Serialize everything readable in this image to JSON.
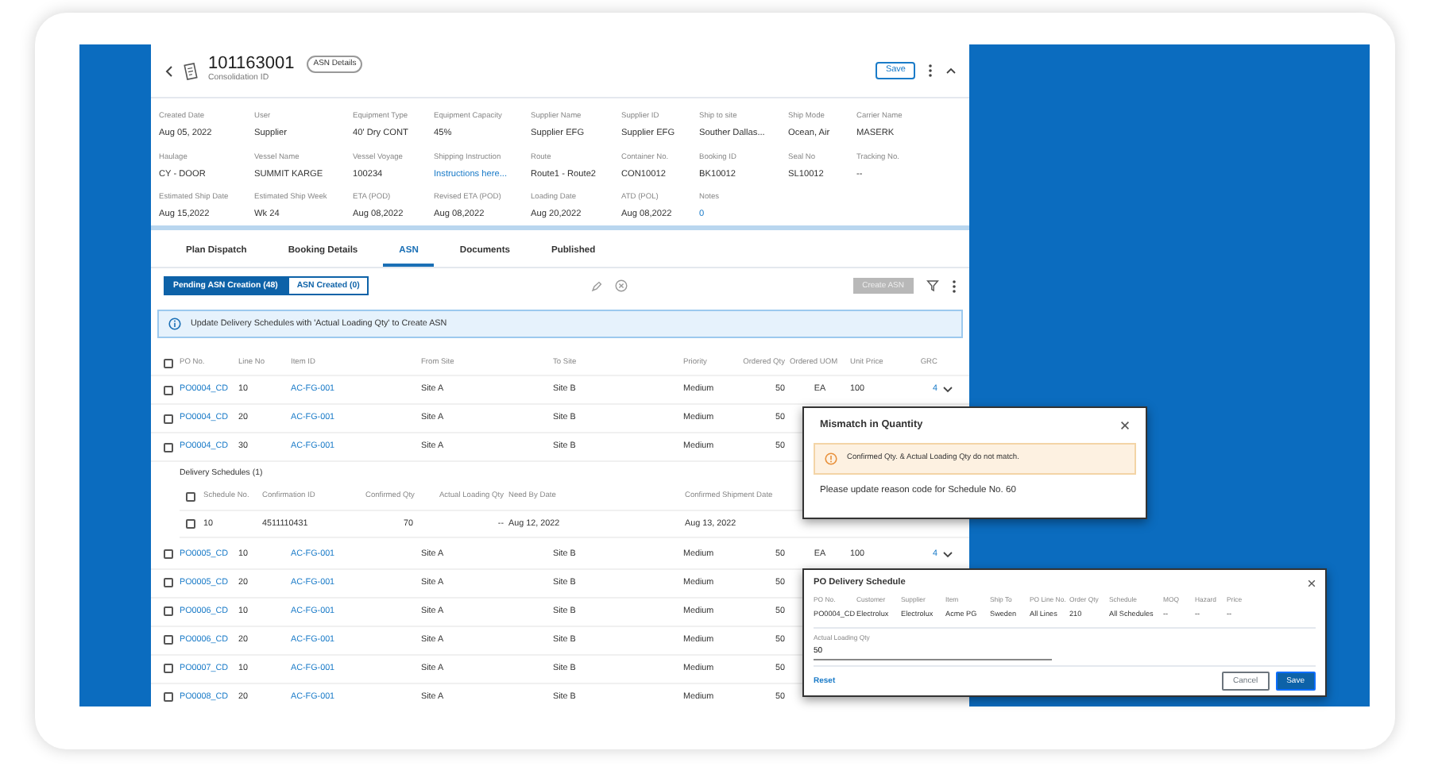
{
  "header": {
    "title": "101163001",
    "badge": "ASN Details",
    "subtitle": "Consolidation ID",
    "save": "Save"
  },
  "fields": [
    [
      {
        "label": "Created Date",
        "value": "Aug 05, 2022"
      },
      {
        "label": "User",
        "value": "Supplier"
      },
      {
        "label": "Equipment Type",
        "value": "40' Dry CONT"
      },
      {
        "label": "Equipment Capacity",
        "value": "45%"
      },
      {
        "label": "Supplier Name",
        "value": "Supplier EFG"
      },
      {
        "label": "Supplier ID",
        "value": "Supplier EFG"
      },
      {
        "label": "Ship to site",
        "value": "Souther Dallas..."
      },
      {
        "label": "Ship Mode",
        "value": "Ocean, Air"
      },
      {
        "label": "Carrier Name",
        "value": "MASERK"
      }
    ],
    [
      {
        "label": "Haulage",
        "value": "CY - DOOR"
      },
      {
        "label": "Vessel Name",
        "value": "SUMMIT KARGE"
      },
      {
        "label": "Vessel Voyage",
        "value": "100234"
      },
      {
        "label": "Shipping Instruction",
        "value": "Instructions here...",
        "link": true
      },
      {
        "label": "Route",
        "value": "Route1 - Route2"
      },
      {
        "label": "Container No.",
        "value": "CON10012"
      },
      {
        "label": "Booking ID",
        "value": "BK10012"
      },
      {
        "label": "Seal No",
        "value": "SL10012"
      },
      {
        "label": "Tracking No.",
        "value": "--"
      }
    ],
    [
      {
        "label": "Estimated Ship Date",
        "value": "Aug 15,2022"
      },
      {
        "label": "Estimated Ship Week",
        "value": "Wk 24"
      },
      {
        "label": "ETA (POD)",
        "value": "Aug 08,2022"
      },
      {
        "label": "Revised ETA (POD)",
        "value": "Aug 08,2022"
      },
      {
        "label": "Loading Date",
        "value": "Aug 20,2022"
      },
      {
        "label": "ATD (POL)",
        "value": "Aug 08,2022"
      },
      {
        "label": "Notes",
        "value": "0",
        "link": true
      }
    ]
  ],
  "tabs": [
    {
      "label": "Plan Dispatch",
      "selected": false
    },
    {
      "label": "Booking Details",
      "selected": false
    },
    {
      "label": "ASN",
      "selected": true
    },
    {
      "label": "Documents",
      "selected": false
    },
    {
      "label": "Published",
      "selected": false
    }
  ],
  "toggle": [
    {
      "label": "Pending ASN Creation (48)",
      "selected": true
    },
    {
      "label": "ASN Created (0)",
      "selected": false
    }
  ],
  "create_button": {
    "label": "Create ASN",
    "disabled": true
  },
  "banner": "Update Delivery Schedules with 'Actual Loading Qty' to Create ASN",
  "table": {
    "select_all_checked": false,
    "columns": [
      "PO No.",
      "Line No",
      "Item ID",
      "From Site",
      "To Site",
      "Priority",
      "Ordered Qty",
      "Ordered UOM",
      "Unit Price",
      "GRC"
    ],
    "rows": [
      {
        "checked": false,
        "cells": [
          "PO0004_CD",
          "10",
          "AC-FG-001",
          "Site A",
          "Site B",
          "Medium",
          "50",
          "EA",
          "100",
          "4"
        ]
      },
      {
        "checked": false,
        "cells": [
          "PO0004_CD",
          "20",
          "AC-FG-001",
          "Site A",
          "Site B",
          "Medium",
          "50"
        ]
      },
      {
        "checked": false,
        "cells": [
          "PO0004_CD",
          "30",
          "AC-FG-001",
          "Site A",
          "Site B",
          "Medium",
          "50"
        ],
        "schedules": {
          "title": "Delivery Schedules (1)",
          "select_all_checked": false,
          "columns": [
            "Schedule No.",
            "Confirmation ID",
            "Confirmed Qty",
            "Actual Loading Qty",
            "Need By Date",
            "Confirmed Shipment Date"
          ],
          "rows": [
            {
              "checked": false,
              "cells": [
                "10",
                "4511110431",
                "70",
                "--",
                "Aug 12, 2022",
                "Aug 13, 2022"
              ]
            }
          ]
        }
      },
      {
        "checked": false,
        "cells": [
          "PO0005_CD",
          "10",
          "AC-FG-001",
          "Site A",
          "Site B",
          "Medium",
          "50",
          "EA",
          "100",
          "4"
        ]
      },
      {
        "checked": false,
        "cells": [
          "PO0005_CD",
          "20",
          "AC-FG-001",
          "Site A",
          "Site B",
          "Medium",
          "50"
        ]
      },
      {
        "checked": false,
        "cells": [
          "PO0006_CD",
          "10",
          "AC-FG-001",
          "Site A",
          "Site B",
          "Medium",
          "50"
        ]
      },
      {
        "checked": false,
        "cells": [
          "PO0006_CD",
          "20",
          "AC-FG-001",
          "Site A",
          "Site B",
          "Medium",
          "50"
        ]
      },
      {
        "checked": false,
        "cells": [
          "PO0007_CD",
          "10",
          "AC-FG-001",
          "Site A",
          "Site B",
          "Medium",
          "50"
        ]
      },
      {
        "checked": false,
        "cells": [
          "PO0008_CD",
          "20",
          "AC-FG-001",
          "Site A",
          "Site B",
          "Medium",
          "50"
        ]
      }
    ]
  },
  "mismatch_dialog": {
    "title": "Mismatch in Quantity",
    "alert": "Confirmed Qty. & Actual Loading Qty do not match.",
    "message": "Please update reason code for Schedule No. 60"
  },
  "po_dialog": {
    "title": "PO Delivery Schedule",
    "fields": [
      {
        "label": "PO No.",
        "value": "PO0004_CD"
      },
      {
        "label": "Customer",
        "value": "Electrolux"
      },
      {
        "label": "Supplier",
        "value": "Electrolux"
      },
      {
        "label": "Item",
        "value": "Acme PG"
      },
      {
        "label": "Ship To",
        "value": "Sweden"
      },
      {
        "label": "PO Line No.",
        "value": "All Lines"
      },
      {
        "label": "Order Qty",
        "value": "210"
      },
      {
        "label": "Schedule",
        "value": "All Schedules"
      },
      {
        "label": "MOQ",
        "value": "--"
      },
      {
        "label": "Hazard",
        "value": "--"
      },
      {
        "label": "Price",
        "value": "--"
      }
    ],
    "qty_label": "Actual Loading Qty",
    "qty_value": "50",
    "reset": "Reset",
    "cancel": "Cancel",
    "save": "Save"
  }
}
